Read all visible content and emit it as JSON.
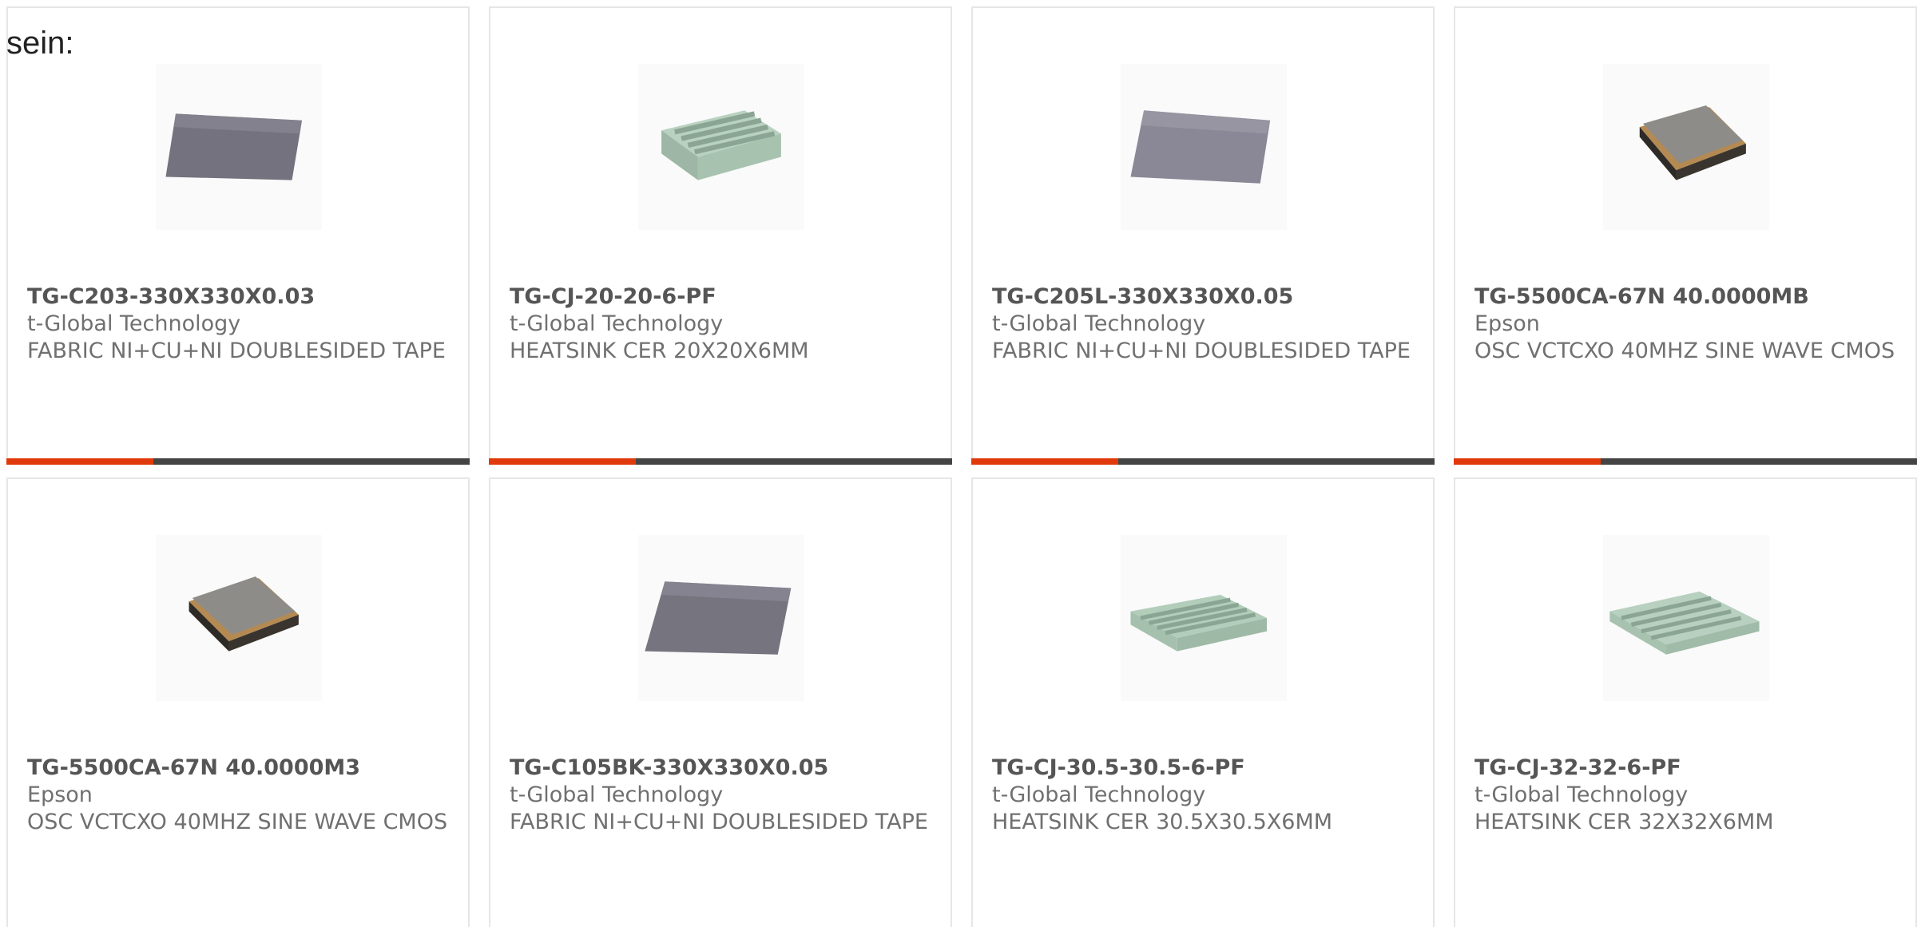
{
  "intro_text": "sein:",
  "colors": {
    "accent": "#e03a0c",
    "bar": "#444444",
    "part_text": "#555555",
    "body_text": "#707070"
  },
  "products": [
    {
      "part": "TG-C203-330X330X0.03",
      "manufacturer": "t-Global Technology",
      "description": "FABRIC NI+CU+NI DOUBLESIDED TAPE",
      "image": "fabric-sheet-icon"
    },
    {
      "part": "TG-CJ-20-20-6-PF",
      "manufacturer": "t-Global Technology",
      "description": "HEATSINK CER 20X20X6MM",
      "image": "ceramic-heatsink-grid-icon"
    },
    {
      "part": "TG-C205L-330X330X0.05",
      "manufacturer": "t-Global Technology",
      "description": "FABRIC NI+CU+NI DOUBLESIDED TAPE",
      "image": "fabric-sheet-icon"
    },
    {
      "part": "TG-5500CA-67N 40.0000MB",
      "manufacturer": "Epson",
      "description": "OSC VCTCXO 40MHZ SINE WAVE CMOS",
      "image": "oscillator-chip-icon"
    },
    {
      "part": "TG-5500CA-67N 40.0000M3",
      "manufacturer": "Epson",
      "description": "OSC VCTCXO 40MHZ SINE WAVE CMOS",
      "image": "oscillator-chip-icon"
    },
    {
      "part": "TG-C105BK-330X330X0.05",
      "manufacturer": "t-Global Technology",
      "description": "FABRIC NI+CU+NI DOUBLESIDED TAPE",
      "image": "fabric-sheet-icon"
    },
    {
      "part": "TG-CJ-30.5-30.5-6-PF",
      "manufacturer": "t-Global Technology",
      "description": "HEATSINK CER 30.5X30.5X6MM",
      "image": "ceramic-heatsink-fins-icon"
    },
    {
      "part": "TG-CJ-32-32-6-PF",
      "manufacturer": "t-Global Technology",
      "description": "HEATSINK CER 32X32X6MM",
      "image": "ceramic-heatsink-fins-icon"
    }
  ]
}
